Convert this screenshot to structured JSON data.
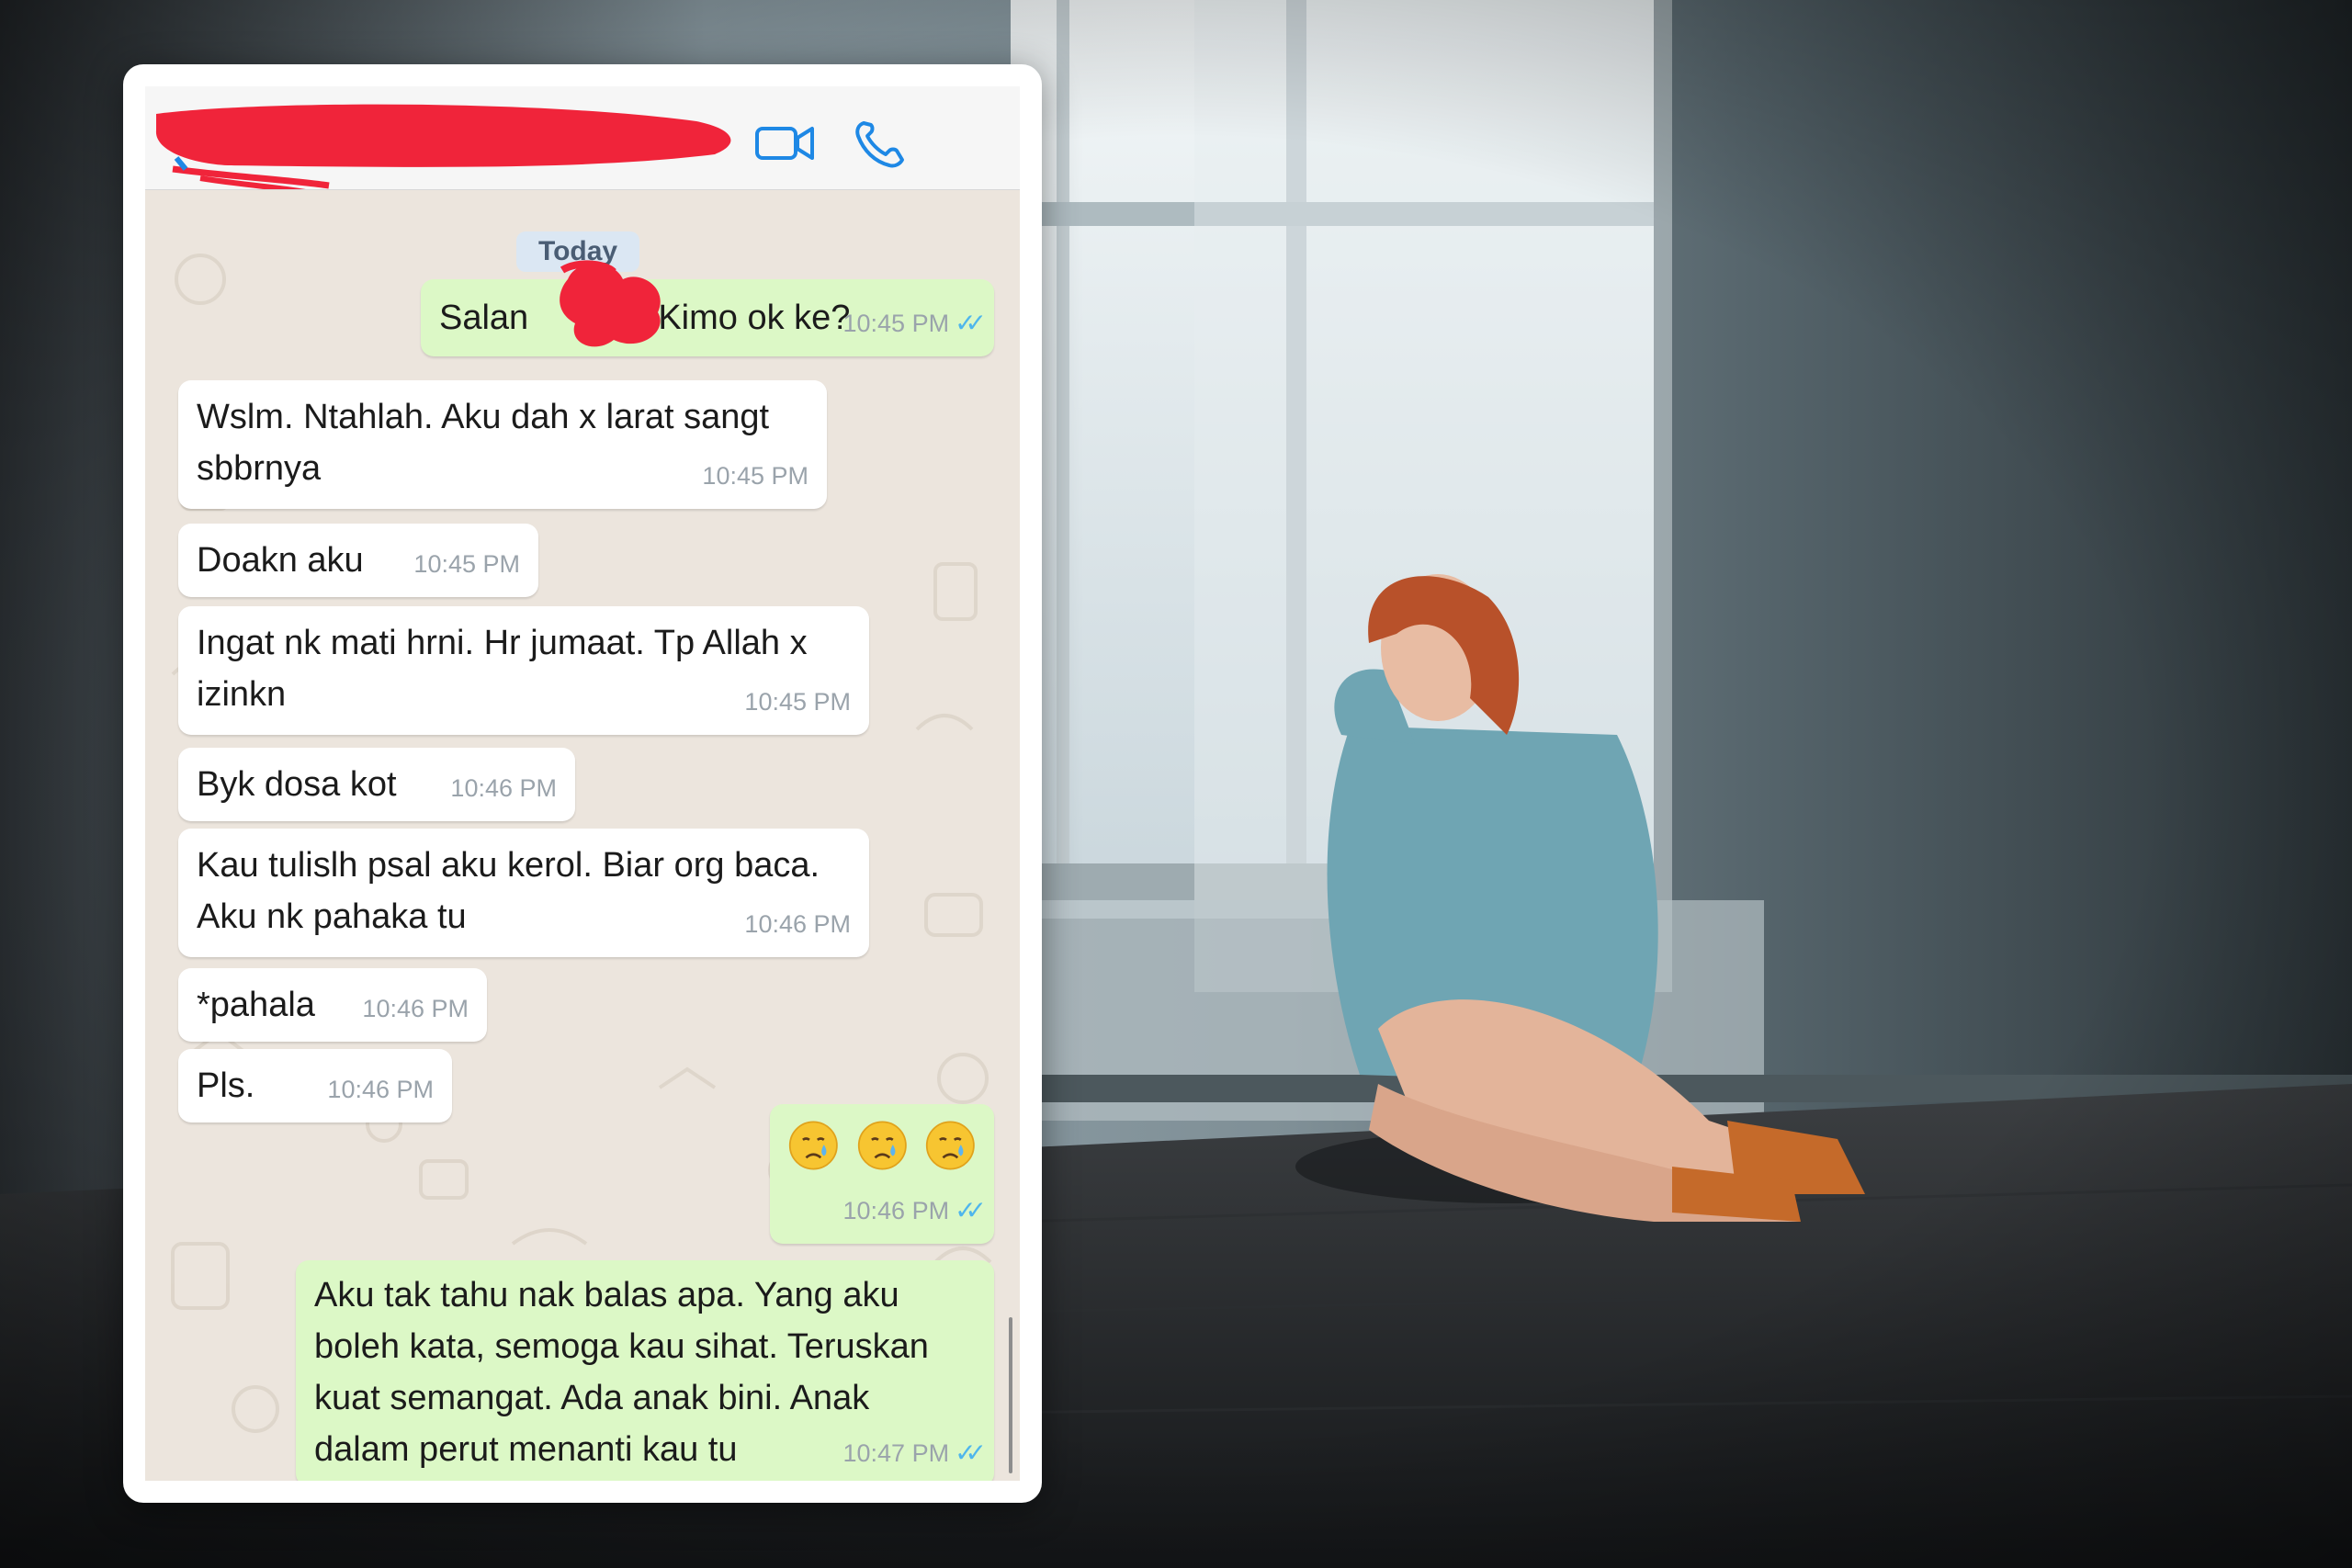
{
  "chat": {
    "date_label": "Today",
    "messages": [
      {
        "side": "out",
        "text_before": "Salan",
        "text_after": ". Kimo ok ke?",
        "time": "10:45 PM",
        "ticks": "✓✓"
      },
      {
        "side": "in",
        "lines": [
          "Wslm. Ntahlah. Aku dah x larat sangt",
          "sbbrnya"
        ],
        "time": "10:45 PM"
      },
      {
        "side": "in",
        "lines": [
          "Doakn aku"
        ],
        "time": "10:45 PM"
      },
      {
        "side": "in",
        "lines": [
          "Ingat nk mati hrni. Hr jumaat. Tp Allah x",
          "izinkn"
        ],
        "time": "10:45 PM"
      },
      {
        "side": "in",
        "lines": [
          "Byk dosa kot"
        ],
        "time": "10:46 PM"
      },
      {
        "side": "in",
        "lines": [
          "Kau tulislh psal aku kerol. Biar org baca.",
          "Aku nk pahaka tu"
        ],
        "time": "10:46 PM"
      },
      {
        "side": "in",
        "lines": [
          "*pahala"
        ],
        "time": "10:46 PM"
      },
      {
        "side": "in",
        "lines": [
          "Pls."
        ],
        "time": "10:46 PM"
      },
      {
        "side": "out",
        "emoji": [
          "crying-face",
          "crying-face",
          "crying-face"
        ],
        "time": "10:46 PM",
        "ticks": "✓✓"
      },
      {
        "side": "out",
        "lines": [
          "Aku tak tahu nak balas apa. Yang aku",
          "boleh kata, semoga kau sihat. Teruskan",
          "kuat semangat. Ada anak bini. Anak",
          "dalam perut menanti kau tu"
        ],
        "time": "10:47 PM",
        "ticks": "✓✓"
      }
    ]
  },
  "header": {
    "icons": [
      "video-call-icon",
      "voice-call-icon"
    ],
    "icon_color": "#1e88e5",
    "redaction_color": "#f0243a"
  },
  "colors": {
    "incoming_bubble": "#ffffff",
    "outgoing_bubble": "#dcf8c6",
    "read_tick": "#4fb6ec",
    "chat_background": "#ece5dd"
  }
}
